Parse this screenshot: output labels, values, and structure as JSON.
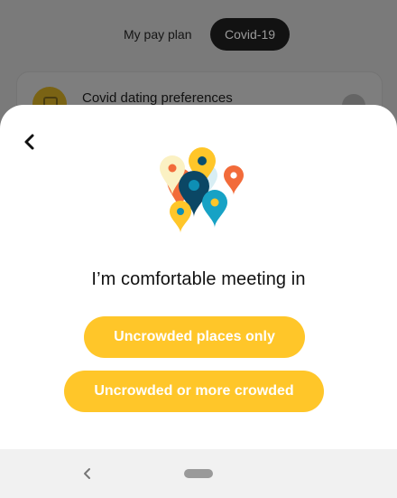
{
  "background_app": {
    "tabs": [
      {
        "label": "My pay plan",
        "active": false
      },
      {
        "label": "Covid-19",
        "active": true
      }
    ],
    "card": {
      "title": "Covid dating preferences",
      "icon": "shield-icon"
    }
  },
  "sheet": {
    "back_icon": "chevron-left-icon",
    "illustration": "map-pins-illustration",
    "question": "I’m comfortable meeting in",
    "options": [
      {
        "label": "Uncrowded places only"
      },
      {
        "label": "Uncrowded or more crowded"
      }
    ],
    "accent_color": "#ffc629"
  },
  "system_nav": {
    "back_icon": "nav-back-icon",
    "home_icon": "home-pill-icon"
  }
}
